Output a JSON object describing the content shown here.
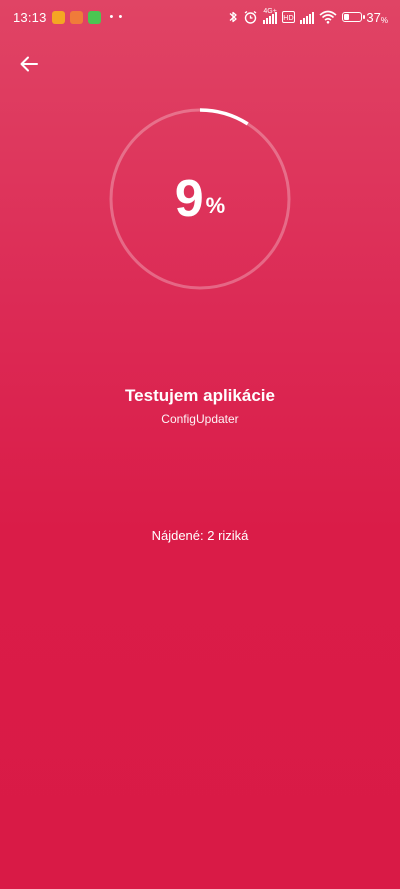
{
  "status_bar": {
    "time": "13:13",
    "notification_icons": [
      "app-icon-orange",
      "app-icon-orange-heart",
      "app-icon-green"
    ],
    "more_dots": "• •",
    "network_label": "4G+",
    "battery_percent": "37",
    "battery_level": 0.37
  },
  "navigation": {
    "back_icon": "arrow-left-icon"
  },
  "progress": {
    "value": 9,
    "unit": "%",
    "fraction": 0.09
  },
  "scan": {
    "title": "Testujem aplikácie",
    "current_app": "ConfigUpdater",
    "found": "Nájdené: 2 riziká"
  },
  "colors": {
    "background_top": "#e04465",
    "background_bottom": "#d91a46",
    "text": "#ffffff",
    "ring_track": "rgba(255,255,255,0.28)"
  }
}
